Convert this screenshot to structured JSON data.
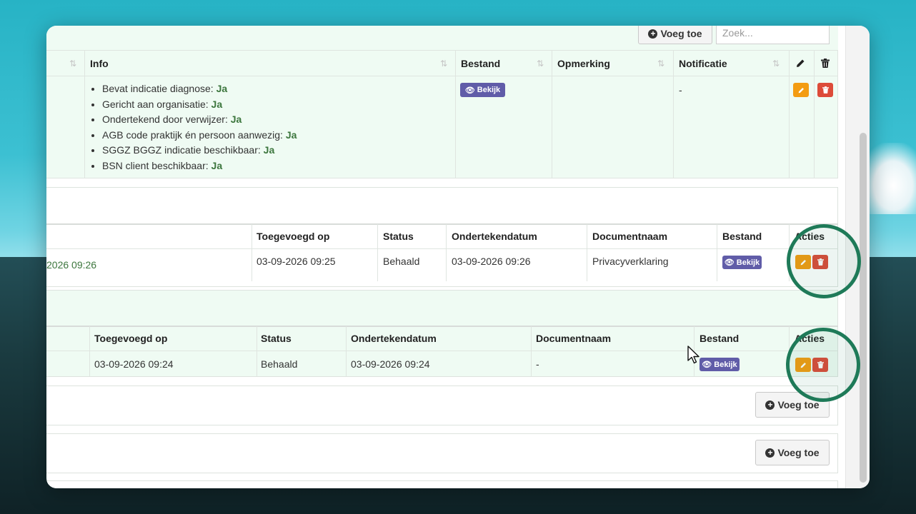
{
  "toolbar": {
    "add_label": "Voeg toe",
    "search_placeholder": "Zoek..."
  },
  "table1": {
    "headers": {
      "info": "Info",
      "bestand": "Bestand",
      "opmerking": "Opmerking",
      "notificatie": "Notificatie"
    },
    "info_items": [
      {
        "label": "Bevat indicatie diagnose:",
        "value": "Ja"
      },
      {
        "label": "Gericht aan organisatie:",
        "value": "Ja"
      },
      {
        "label": "Ondertekend door verwijzer:",
        "value": "Ja"
      },
      {
        "label": "AGB code praktijk én persoon aanwezig:",
        "value": "Ja"
      },
      {
        "label": "SGGZ BGGZ indicatie beschikbaar:",
        "value": "Ja"
      },
      {
        "label": "BSN client beschikbaar:",
        "value": "Ja"
      }
    ],
    "view_label": "Bekijk",
    "notificatie_value": "-"
  },
  "table2": {
    "headers": {
      "toegevoegd": "Toegevoegd op",
      "status": "Status",
      "ondertekend": "Ondertekendatum",
      "documentnaam": "Documentnaam",
      "bestand": "Bestand",
      "acties": "Acties"
    },
    "row": {
      "partial_date": "2026 09:26",
      "toegevoegd": "03-09-2026 09:25",
      "status": "Behaald",
      "ondertekend": "03-09-2026 09:26",
      "documentnaam": "Privacyverklaring",
      "view_label": "Bekijk"
    }
  },
  "table3": {
    "headers": {
      "toegevoegd": "Toegevoegd op",
      "status": "Status",
      "ondertekend": "Ondertekendatum",
      "documentnaam": "Documentnaam",
      "bestand": "Bestand",
      "acties": "Acties"
    },
    "row": {
      "toegevoegd": "03-09-2026 09:24",
      "status": "Behaald",
      "ondertekend": "03-09-2026 09:24",
      "documentnaam": "-",
      "view_label": "Bekijk"
    }
  },
  "section4": {
    "add_label": "Voeg toe"
  },
  "section5": {
    "add_label": "Voeg toe"
  },
  "colors": {
    "view_button": "#605ca8",
    "edit_button": "#f39c12",
    "delete_button": "#dd4b39",
    "highlight_ring": "#1e7a58",
    "green_panel": "#effbf3"
  },
  "icons": {
    "add": "plus-circle-icon",
    "edit": "pencil-icon",
    "delete": "trash-icon",
    "view": "eye-icon",
    "sort": "sort-icon"
  }
}
